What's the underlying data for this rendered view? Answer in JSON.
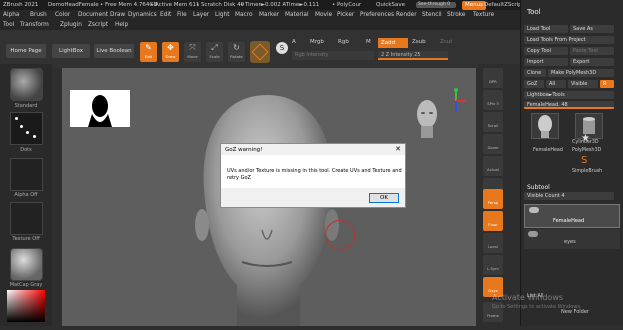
{
  "titlebar": {
    "app": "ZBrush 2021",
    "doc": "DemoHeadFemale",
    "free_mem": "• Free Mem 4.764GB",
    "active_mem": "• Active Mem 611",
    "scratch": "• Scratch Disk 49",
    "timer": "• Timer►0.002 ATime►0.111",
    "polycount": "• PolyCour",
    "quicksave": "QuickSave",
    "seethrough": "See-through 0",
    "menus": "Menus",
    "default_script": "DefaultZScript"
  },
  "menubar": {
    "row1": [
      "Alpha",
      "Brush",
      "Color",
      "Document",
      "Draw",
      "Dynamics",
      "Edit",
      "File",
      "Layer",
      "Light",
      "Macro",
      "Marker",
      "Material",
      "Movie",
      "Picker",
      "Preferences",
      "Render",
      "Stencil",
      "Stroke",
      "Texture"
    ],
    "row2": [
      "Tool",
      "Transform",
      "Zplugin",
      "Zscript",
      "Help"
    ]
  },
  "shelf": {
    "home": "Home Page",
    "lightbox": "LightBox",
    "live_boolean": "Live Boolean",
    "tools": [
      "Edit",
      "Draw",
      "Move",
      "Scale",
      "Rotate"
    ],
    "s_label": "S",
    "a_label": "A",
    "mrgb": "Mrgb",
    "rgb": "Rgb",
    "m": "M",
    "zadd": "Zadd",
    "zsub": "Zsub",
    "zcut": "Zcut",
    "rgb_intensity": "Rgb Intensity",
    "z_intensity": "Z Intensity 25",
    "focal_val": "2"
  },
  "leftshelf": {
    "standard": "Standard",
    "dots": "Dots",
    "alpha_off": "Alpha Off",
    "texture_off": "Texture Off",
    "matcap": "MatCap Gray"
  },
  "rightshelf": {
    "buttons": [
      "BPR",
      "SPix 3",
      "Scroll",
      "Zoom",
      "Actual",
      "AAHalf",
      "Persp",
      "Floor",
      "Local",
      "L.Sym",
      "Gxyz",
      "Frame"
    ]
  },
  "toolpanel": {
    "header": "Tool",
    "load_tool": "Load Tool",
    "save_as": "Save As",
    "load_from_project": "Load Tools From Project",
    "copy_tool": "Copy Tool",
    "paste_tool": "Paste Tool",
    "import": "Import",
    "export": "Export",
    "clone": "Clone",
    "make_polymesh": "Make PolyMesh3D",
    "goz": "GoZ",
    "all": "All",
    "visible": "Visible",
    "r": "R",
    "lightbox_tools": "Lightbox►Tools",
    "current_tool": "FemaleHead. 48",
    "thumbs": [
      "FemaleHead",
      "Cylinder3D",
      "PolyMesh3D",
      "SimpleBrush"
    ],
    "subtool_header": "Subtool",
    "visible_count": "Visible Count 4",
    "subtools": [
      "FemaleHead",
      "eyes"
    ],
    "list_all": "List All",
    "new_folder": "New Folder"
  },
  "dialog": {
    "title": "GoZ warning!",
    "close": "✕",
    "message": "UVs and/or Texture is missing in this tool. Create UVs and Texture and retry GoZ",
    "ok": "OK"
  },
  "watermark": {
    "title": "Activate Windows",
    "subtitle": "Go to Settings to activate Windows."
  },
  "colors": {
    "accent": "#e8781e",
    "background": "#2e2e2e",
    "canvas": "#5e5e5e"
  }
}
